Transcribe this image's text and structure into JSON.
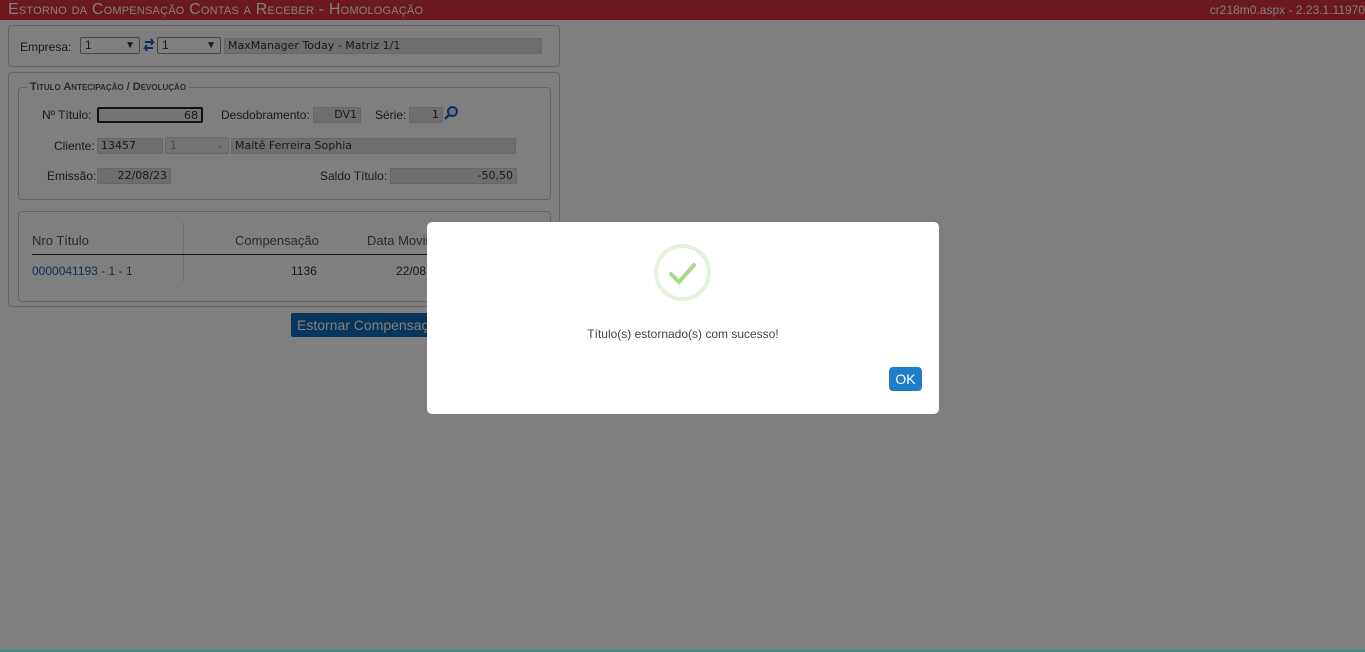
{
  "header": {
    "title": "Estorno da Compensação Contas a Receber  - Homologação",
    "version": "cr218m0.aspx - 2.23.1.11970"
  },
  "empresa": {
    "label": "Empresa:",
    "select1": "1",
    "select2": "1",
    "name": "MaxManager Today - Matriz 1/1"
  },
  "titulo": {
    "legend": "Titulo Antecipação / Devolução",
    "numero_label": "Nº Título:",
    "numero_value": "68",
    "desdobramento_label": "Desdobramento:",
    "desdobramento_value": "DV1",
    "serie_label": "Série:",
    "serie_value": "1",
    "cliente_label": "Cliente:",
    "cliente_codigo": "13457",
    "cliente_select": "1",
    "cliente_nome": "Maitê Ferreira Sophia",
    "emissao_label": "Emissão:",
    "emissao_value": "22/08/23",
    "saldo_label": "Saldo Título:",
    "saldo_value": "-50,50"
  },
  "grid": {
    "columns": [
      "Nro Título",
      "Compensação",
      "Data Movim"
    ],
    "rows": [
      {
        "nro": "0000041193 - 1 - 1",
        "compensacao": "1136",
        "data": "22/08"
      }
    ]
  },
  "action_button": "Estornar Compensaçã",
  "modal": {
    "message": "Título(s) estornado(s) com sucesso!",
    "ok_label": "OK",
    "icon": "check-icon",
    "accent": "#a5dc86",
    "button_color": "#1e7ec8"
  }
}
